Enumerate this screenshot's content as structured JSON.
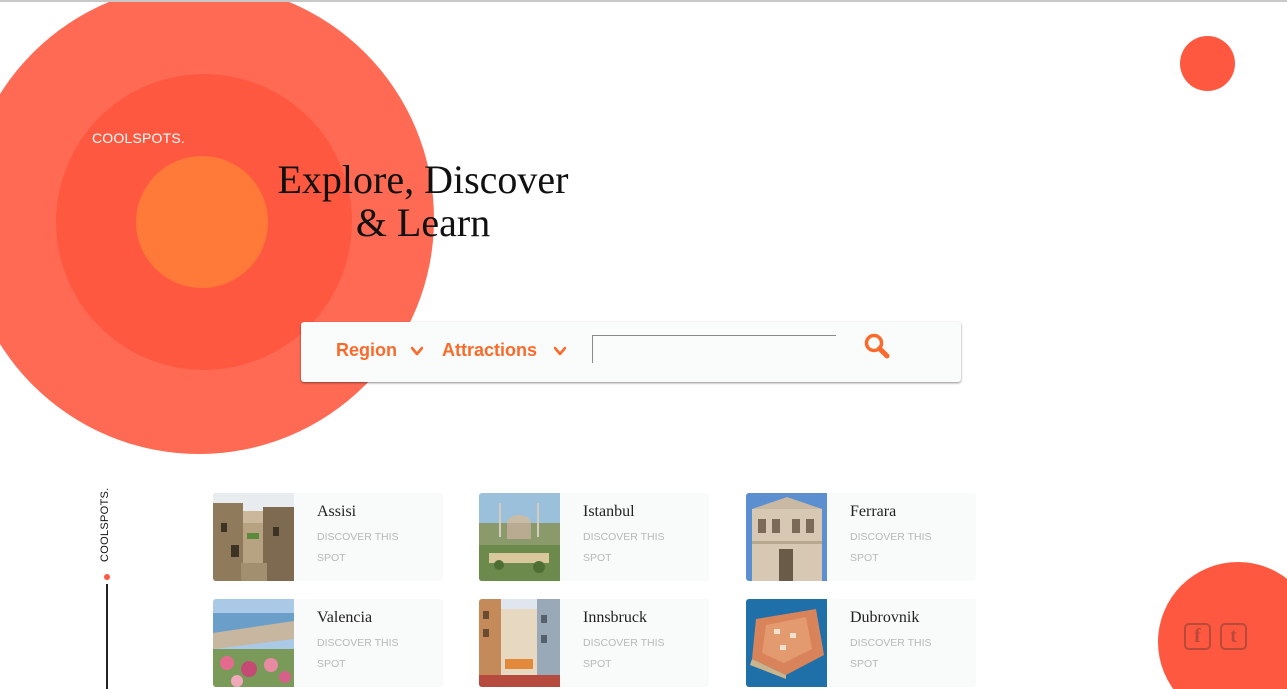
{
  "brand": {
    "name": "COOLSPOTS."
  },
  "hero": {
    "line1": "Explore, Discover",
    "line2": "& Learn"
  },
  "search": {
    "region_label": "Region",
    "attractions_label": "Attractions",
    "query": "",
    "placeholder": ""
  },
  "side": {
    "brand": "COOLSPOTS."
  },
  "spots": [
    {
      "name": "Assisi",
      "cta": "DISCOVER THIS SPOT"
    },
    {
      "name": "Istanbul",
      "cta": "DISCOVER THIS SPOT"
    },
    {
      "name": "Ferrara",
      "cta": "DISCOVER THIS SPOT"
    },
    {
      "name": "Valencia",
      "cta": "DISCOVER THIS SPOT"
    },
    {
      "name": "Innsbruck",
      "cta": "DISCOVER THIS SPOT"
    },
    {
      "name": "Dubrovnik",
      "cta": "DISCOVER THIS SPOT"
    }
  ],
  "social": {
    "facebook_icon": "facebook-icon",
    "twitter_icon": "twitter-icon"
  },
  "colors": {
    "accent": "#ff5840",
    "accent_light": "#ff6a55",
    "accent_orange": "#ff7a38",
    "link_orange": "#fb6a2a",
    "card_bg": "#f8fbfa"
  }
}
